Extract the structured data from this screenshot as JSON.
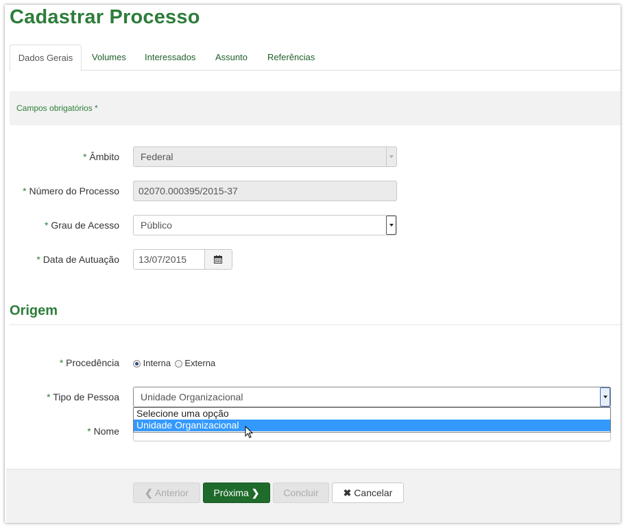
{
  "page": {
    "title": "Cadastrar Processo"
  },
  "tabs": [
    {
      "label": "Dados Gerais",
      "active": true
    },
    {
      "label": "Volumes"
    },
    {
      "label": "Interessados"
    },
    {
      "label": "Assunto"
    },
    {
      "label": "Referências"
    }
  ],
  "required_note": "Campos obrigatórios *",
  "form": {
    "ambito": {
      "label": "Âmbito",
      "value": "Federal"
    },
    "numero": {
      "label": "Número do Processo",
      "value": "02070.000395/2015-37"
    },
    "grau": {
      "label": "Grau de Acesso",
      "value": "Público"
    },
    "data": {
      "label": "Data de Autuação",
      "value": "13/07/2015"
    }
  },
  "origem": {
    "title": "Origem",
    "procedencia": {
      "label": "Procedência",
      "options": [
        "Interna",
        "Externa"
      ],
      "selected": "Interna"
    },
    "tipo_pessoa": {
      "label": "Tipo de Pessoa",
      "value": "Unidade Organizacional",
      "options": [
        "Selecione uma opção",
        "Unidade Organizacional"
      ],
      "highlighted": "Unidade Organizacional"
    },
    "nome": {
      "label": "Nome"
    }
  },
  "required_marker": "*",
  "buttons": {
    "anterior": "Anterior",
    "proxima": "Próxima",
    "concluir": "Concluir",
    "cancelar": "Cancelar"
  },
  "colors": {
    "brand": "#2d7d3a",
    "primary_button": "#1f6b2c",
    "highlight": "#3399ff"
  }
}
